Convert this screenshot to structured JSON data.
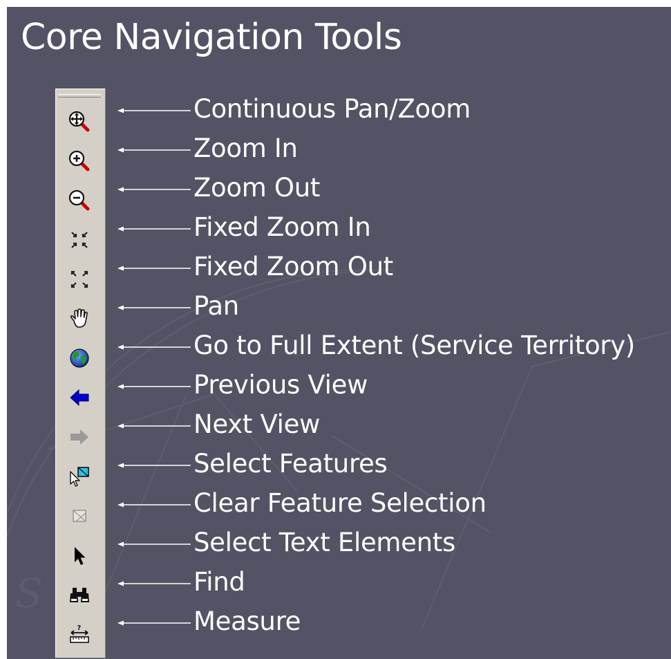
{
  "title": "Core Navigation Tools",
  "tools": [
    {
      "label": "Continuous Pan/Zoom",
      "icon": "continuous-pan-zoom-icon"
    },
    {
      "label": "Zoom In",
      "icon": "zoom-in-icon"
    },
    {
      "label": "Zoom Out",
      "icon": "zoom-out-icon"
    },
    {
      "label": "Fixed Zoom In",
      "icon": "fixed-zoom-in-icon"
    },
    {
      "label": "Fixed Zoom Out",
      "icon": "fixed-zoom-out-icon"
    },
    {
      "label": "Pan",
      "icon": "hand-pan-icon"
    },
    {
      "label": "Go to Full Extent (Service Territory)",
      "icon": "globe-icon"
    },
    {
      "label": "Previous View",
      "icon": "arrow-left-icon"
    },
    {
      "label": "Next View",
      "icon": "arrow-right-icon"
    },
    {
      "label": "Select Features",
      "icon": "select-features-icon"
    },
    {
      "label": "Clear Feature Selection",
      "icon": "clear-selection-icon"
    },
    {
      "label": "Select Text Elements",
      "icon": "pointer-arrow-icon"
    },
    {
      "label": "Find",
      "icon": "binoculars-icon"
    },
    {
      "label": "Measure",
      "icon": "measure-icon"
    }
  ],
  "colors": {
    "background": "#535365",
    "toolbar": "#d4d0c8",
    "text": "#ffffff",
    "magnifier_handle": "#cc0000",
    "previous_arrow": "#0000cc",
    "next_arrow_disabled": "#9a9a9a"
  },
  "states": {
    "next_view_enabled": false,
    "clear_feature_selection_enabled": false
  }
}
